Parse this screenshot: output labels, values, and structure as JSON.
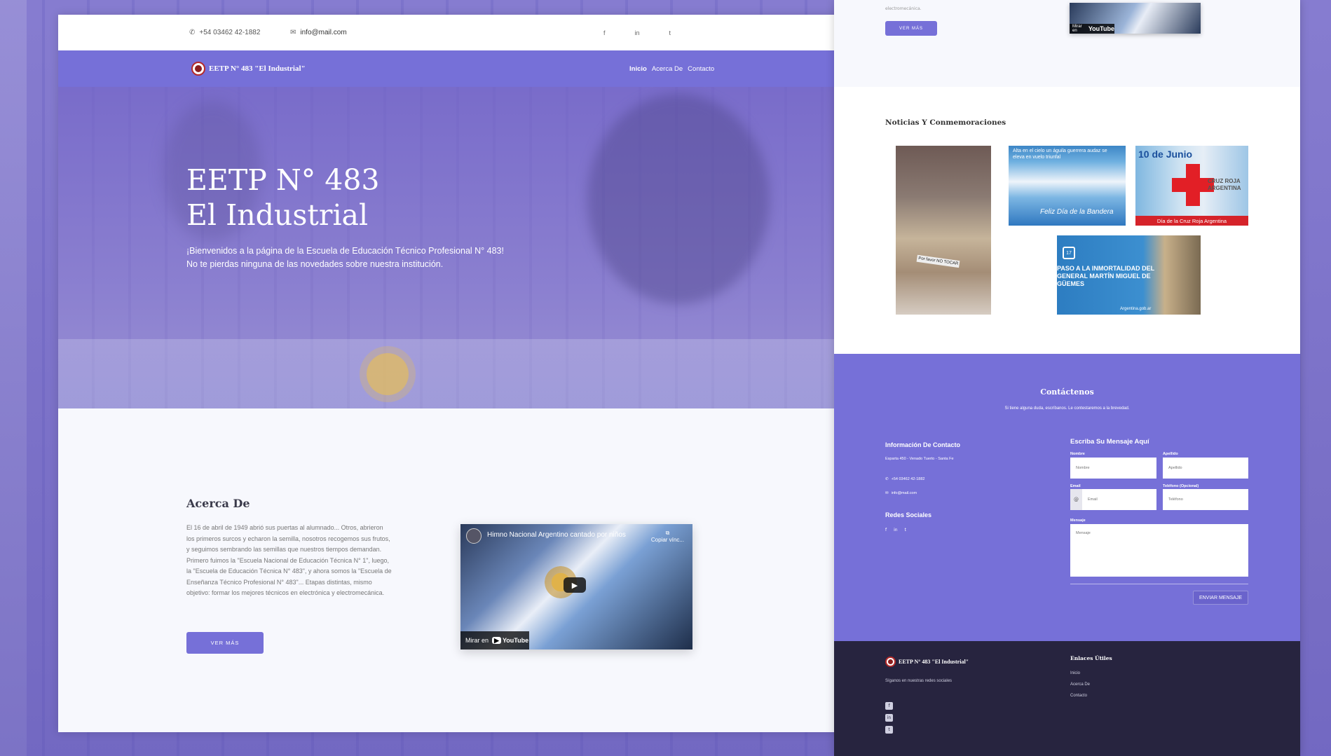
{
  "colors": {
    "primary": "#7670d8",
    "footer": "#27243f",
    "background": "#7a70c8"
  },
  "topbar": {
    "phone": "+54 03462 42-1882",
    "email": "info@mail.com",
    "socials": [
      "f",
      "in",
      "t"
    ]
  },
  "navbar": {
    "brand": "EETP N° 483 \"El Industrial\"",
    "menu": [
      "Inicio",
      "Acerca De",
      "Contacto"
    ]
  },
  "hero": {
    "title_line1": "EETP N° 483",
    "title_line2": "El Industrial",
    "text": "¡Bienvenidos a la página de la Escuela de Educación Técnico Profesional N° 483! No te pierdas ninguna de las novedades sobre nuestra institución."
  },
  "about": {
    "title": "Acerca De",
    "text": "El 16 de abril de 1949 abrió sus puertas al alumnado... Otros, abrieron los primeros surcos y echaron la semilla, nosotros recogemos sus frutos, y seguimos sembrando las semillas que nuestros tiempos demandan. Primero fuimos la \"Escuela Nacional de Educación Técnica N° 1\", luego, la \"Escuela de Educación Técnica N° 483\", y ahora somos la \"Escuela de Enseñanza Técnico Profesional N° 483\"... Etapas distintas, mismo objetivo: formar los mejores técnicos en electrónica y electromecánica.",
    "button": "VER MÁS",
    "video": {
      "title": "Himno Nacional Argentino cantado por niños",
      "copy": "Copiar vínc...",
      "watch_on": "Mirar en",
      "youtube": "YouTube"
    }
  },
  "right_top": {
    "text": "electromecánica.",
    "button": "VER MÁS",
    "watch_on": "Mirar en",
    "youtube": "YouTube"
  },
  "news": {
    "title": "Noticias Y Conmemoraciones",
    "items": [
      {
        "caption": "",
        "sign": "Por favor NO TOCAR"
      },
      {
        "caption": "Alta en el cielo un águila guerrera audaz se eleva en vuelo triunfal",
        "footer": "Feliz Día de la Bandera"
      },
      {
        "day": "10 de Junio",
        "org": "CRUZ ROJA ARGENTINA",
        "band": "Día de la Cruz Roja Argentina"
      },
      {
        "badge": "17",
        "text": "PASO A LA INMORTALIDAD DEL GENERAL MARTÍN MIGUEL DE GÜEMES",
        "site": "Argentina.gob.ar"
      }
    ]
  },
  "contact": {
    "title": "Contáctenos",
    "subtitle": "Si tiene alguna duda, escríbanos. Le contestaremos a la brevedad.",
    "info_title": "Información De Contacto",
    "address": "Esparta 450 - Venado Tuerto - Santa Fe",
    "phone": "+54 03462 42-1882",
    "email": "info@mail.com",
    "social_title": "Redes Sociales",
    "socials": [
      "f",
      "in",
      "t"
    ],
    "form_title": "Escriba Su Mensaje Aquí",
    "labels": {
      "name": "Nombre",
      "lastname": "Apellido",
      "email": "Email",
      "phone": "Teléfono (Opcional)",
      "message": "Mensaje"
    },
    "placeholders": {
      "name": "Nombre",
      "lastname": "Apellido",
      "email": "Email",
      "phone": "Teléfono",
      "message": "Mensaje"
    },
    "send": "ENVIAR MENSAJE"
  },
  "footer": {
    "brand": "EETP N° 483 \"El Industrial\"",
    "follow": "Síganos en nuestras redes sociales",
    "socials": [
      "f",
      "in",
      "t"
    ],
    "links_title": "Enlaces Útiles",
    "links": [
      "Inicio",
      "Acerca De",
      "Contacto"
    ]
  }
}
